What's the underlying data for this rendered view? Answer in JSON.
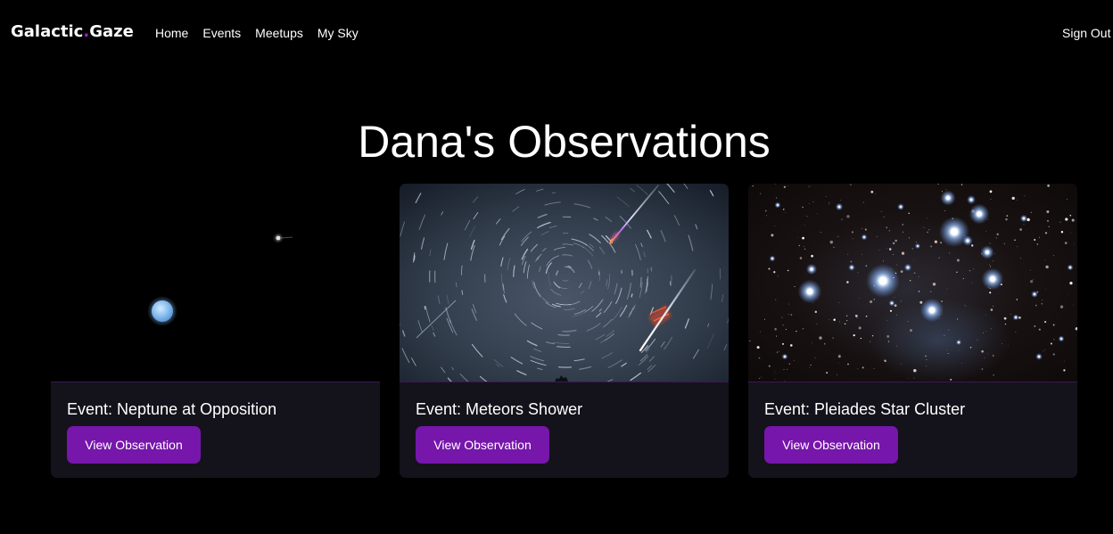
{
  "colors": {
    "background": "#000000",
    "text": "#ffffff",
    "logo_dot": "#a11fd6",
    "accent": "#7616ab",
    "card_body": "#14121a",
    "card_divider": "#3d1756"
  },
  "app": {
    "logo": {
      "part1": "Galactic",
      "dot": ".",
      "part2": "Gaze"
    },
    "nav": [
      {
        "label": "Home"
      },
      {
        "label": "Events"
      },
      {
        "label": "Meetups"
      },
      {
        "label": "My Sky"
      }
    ],
    "sign_out": "Sign Out"
  },
  "page": {
    "title": "Dana's Observations"
  },
  "cards": [
    {
      "event": "Event: Neptune at Opposition",
      "button": "View Observation"
    },
    {
      "event": "Event: Meteors Shower",
      "button": "View Observation"
    },
    {
      "event": "Event: Pleiades Star Cluster",
      "button": "View Observation"
    }
  ]
}
